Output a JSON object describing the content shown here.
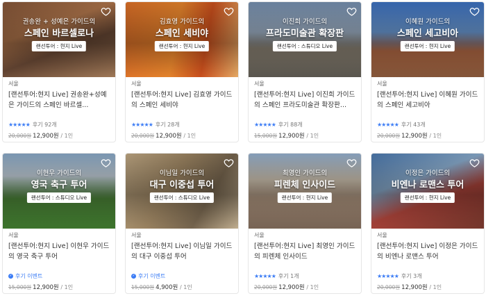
{
  "colors": {
    "accent": "#3b7cf5"
  },
  "cards": [
    {
      "ov1": "권송완 + 성예은 가이드의",
      "ov2": "스페인 바르셀로나",
      "badge": "랜선투어 : 현지 Live",
      "city": "서울",
      "title": "[랜선투어:현지 Live] 권송완+성예은 가이드의 스페인 바르셀...",
      "stars": "★★★★★",
      "reviews": "후기 92개",
      "orig": "20,000원",
      "price": "12,900원",
      "per": "/ 1인"
    },
    {
      "ov1": "김효영 가이드의",
      "ov2": "스페인 세비야",
      "badge": "랜선투어 : 현지 Live",
      "city": "서울",
      "title": "[랜선투어:현지 Live] 김효영 가이드의 스페인 세비야",
      "stars": "★★★★★",
      "reviews": "후기 28개",
      "orig": "20,000원",
      "price": "12,900원",
      "per": "/ 1인"
    },
    {
      "ov1": "이진희 가이드의",
      "ov2": "프라도미술관 확장판",
      "badge": "랜선투어 : 스튜디오 Live",
      "city": "서울",
      "title": "[랜선투어:현지 Live] 이진희 가이드의 스페인 프라도미술관 확장판...",
      "stars": "★★★★★",
      "reviews": "후기 88개",
      "orig": "15,000원",
      "price": "12,900원",
      "per": "/ 1인"
    },
    {
      "ov1": "이혜원 가이드의",
      "ov2": "스페인 세고비아",
      "badge": "랜선투어 : 현지 Live",
      "city": "서울",
      "title": "[랜선투어:현지 Live] 이혜원 가이드의 스페인 세고비아",
      "stars": "★★★★★",
      "reviews": "후기 43개",
      "orig": "20,000원",
      "price": "12,900원",
      "per": "/ 1인"
    },
    {
      "ov1": "이현우 가이드의",
      "ov2": "영국 축구 투어",
      "badge": "랜선투어 : 스튜디오 Live",
      "city": "서울",
      "title": "[랜선투어:현지 Live] 이현우 가이드의 영국 축구 투어",
      "stars": "",
      "reviews": "후기 이벤트",
      "event": true,
      "orig": "15,000원",
      "price": "12,900원",
      "per": "/ 1인"
    },
    {
      "ov1": "이님일 가이드의",
      "ov2": "대구 이중섭 투어",
      "badge": "랜선투어 : 스튜디오 Live",
      "city": "서울",
      "title": "[랜선투어:현지 Live] 이님일 가이드의 대구 이중섭 투어",
      "stars": "",
      "reviews": "후기 이벤트",
      "event": true,
      "orig": "15,000원",
      "price": "4,900원",
      "per": "/ 1인"
    },
    {
      "ov1": "최영인 가이드의",
      "ov2": "피렌체 인사이드",
      "badge": "랜선투어 : 현지 Live",
      "city": "서울",
      "title": "[랜선투어:현지 Live] 최영인 가이드의 피렌체 인사이드",
      "stars": "★★★★★",
      "reviews": "후기 1개",
      "orig": "20,000원",
      "price": "12,900원",
      "per": "/ 1인"
    },
    {
      "ov1": "이정은 가이드의",
      "ov2": "비엔나 로맨스 투어",
      "badge": "랜선투어 : 현지 Live",
      "city": "서울",
      "title": "[랜선투어:현지 Live] 이정은 가이드의 비엔나 로맨스 투어",
      "stars": "★★★★★",
      "reviews": "후기 3개",
      "orig": "20,000원",
      "price": "12,900원",
      "per": "/ 1인"
    }
  ]
}
